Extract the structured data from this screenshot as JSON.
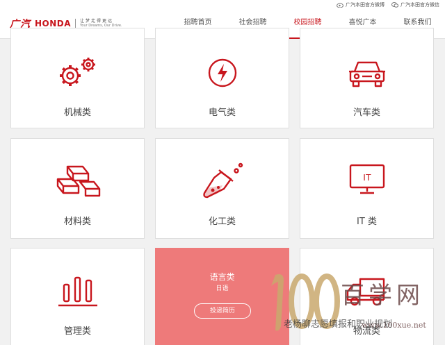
{
  "header": {
    "logo_gac": "广汽",
    "logo_honda": "HONDA",
    "slogan_cn": "让梦走得更远",
    "slogan_en": "Your Dreams, Our Drive.",
    "social": [
      {
        "label": "广汽本田官方微博",
        "icon": "weibo-icon"
      },
      {
        "label": "广汽本田官方微信",
        "icon": "wechat-icon"
      }
    ],
    "nav": [
      {
        "label": "招聘首页",
        "active": false
      },
      {
        "label": "社会招聘",
        "active": false
      },
      {
        "label": "校园招聘",
        "active": true
      },
      {
        "label": "喜悦广本",
        "active": false
      },
      {
        "label": "联系我们",
        "active": false
      }
    ]
  },
  "cards": [
    {
      "label": "机械类",
      "icon": "gears-icon"
    },
    {
      "label": "电气类",
      "icon": "lightning-icon"
    },
    {
      "label": "汽车类",
      "icon": "car-icon"
    },
    {
      "label": "材料类",
      "icon": "ingots-icon"
    },
    {
      "label": "化工类",
      "icon": "flask-icon"
    },
    {
      "label": "IT 类",
      "icon": "monitor-icon",
      "icon_text": "IT"
    },
    {
      "label": "管理类",
      "icon": "bar-chart-icon"
    },
    {
      "label": "语言类",
      "sub": "日语",
      "button": "投递简历",
      "highlight": true
    },
    {
      "label": "物流类",
      "icon": "truck-icon"
    }
  ],
  "watermark": {
    "number": "100",
    "brand": "百学网",
    "url": "www.100xue.net",
    "caption": "老杨聊志愿填报和职业规划"
  },
  "colors": {
    "brand_red": "#c8161d",
    "highlight_pink": "#ee7a7a"
  }
}
